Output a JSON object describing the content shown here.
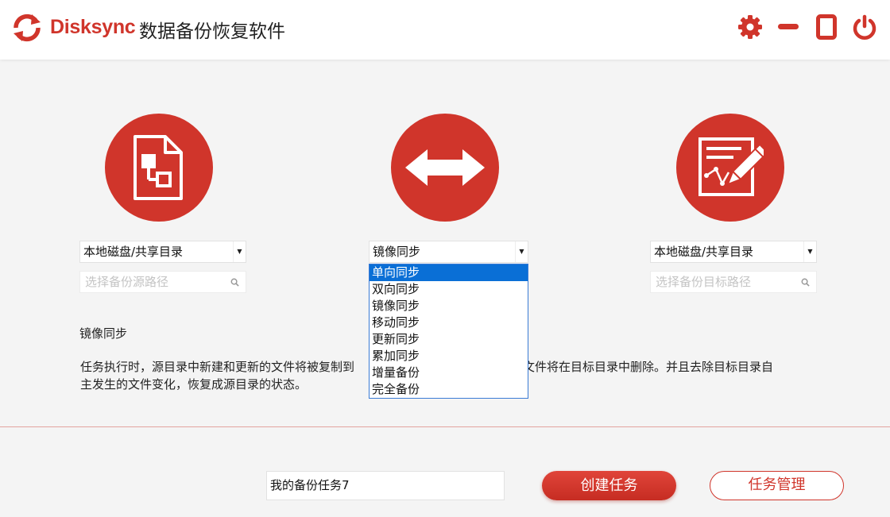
{
  "header": {
    "brand": "Disksync",
    "title": "数据备份恢复软件",
    "accent": "#d0352b",
    "icons": [
      "refresh-logo-icon",
      "gear-icon",
      "minimize-icon",
      "maximize-icon",
      "power-icon"
    ]
  },
  "source": {
    "icon": "file-flowchart-icon",
    "select_value": "本地磁盘/共享目录",
    "search_placeholder": "选择备份源路径"
  },
  "mode": {
    "icon": "double-arrow-icon",
    "select_value": "镜像同步",
    "options": [
      "单向同步",
      "双向同步",
      "镜像同步",
      "移动同步",
      "更新同步",
      "累加同步",
      "增量备份",
      "完全备份"
    ],
    "highlighted_option": "单向同步"
  },
  "target": {
    "icon": "edit-document-icon",
    "select_value": "本地磁盘/共享目录",
    "search_placeholder": "选择备份目标路径"
  },
  "description": {
    "title": "镜像同步",
    "text_before": "任务执行时，源目录中新建和更新的文件将被复制到",
    "text_after": "的文件将在目标目录中删除。并且去除目标目录自",
    "text_line2": "主发生的文件变化，恢复成源目录的状态。"
  },
  "footer": {
    "task_name": "我的备份任务7",
    "create_label": "创建任务",
    "manage_label": "任务管理"
  }
}
